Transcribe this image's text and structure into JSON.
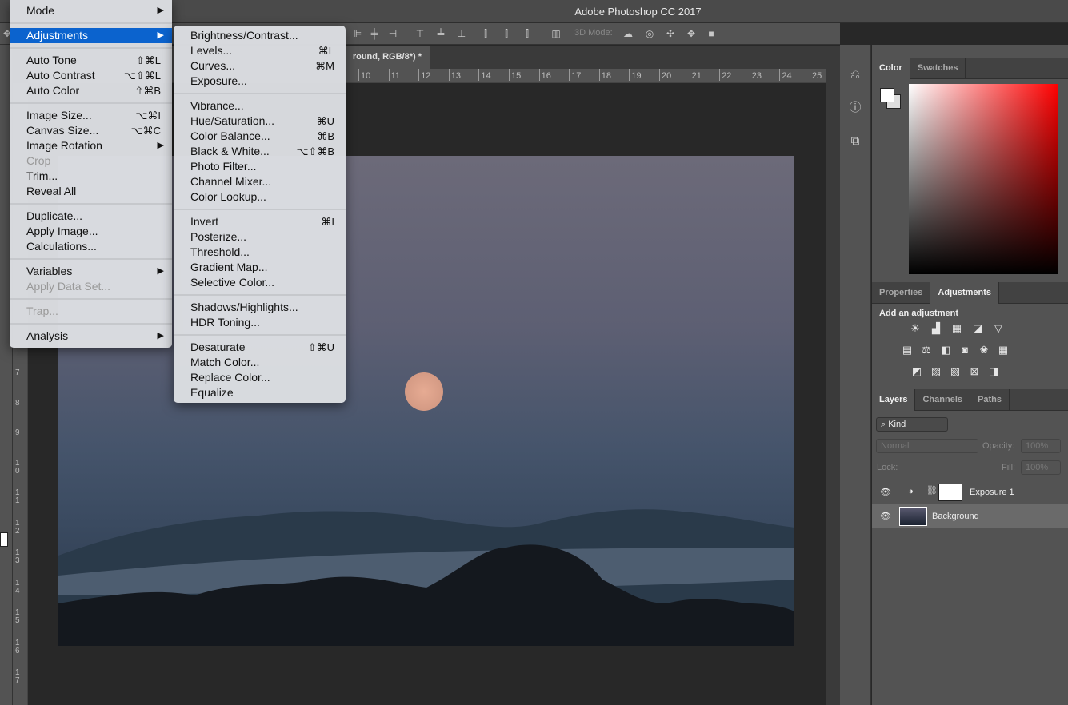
{
  "app": {
    "title": "Adobe Photoshop CC 2017",
    "doc_tab": "round, RGB/8*) *"
  },
  "options_bar": {
    "mode_3d_label": "3D Mode:"
  },
  "rulers": {
    "horizontal": [
      "10",
      "11",
      "12",
      "13",
      "14",
      "15",
      "16",
      "17",
      "18",
      "19",
      "20",
      "21",
      "22",
      "23",
      "24",
      "25"
    ],
    "vertical": [
      "7",
      "8",
      "9",
      "10",
      "11",
      "12",
      "13",
      "14",
      "15",
      "16",
      "17"
    ]
  },
  "main_menu": [
    {
      "label": "Mode",
      "arrow": true
    },
    {
      "sep": true
    },
    {
      "label": "Adjustments",
      "arrow": true,
      "highlight": true
    },
    {
      "sep": true
    },
    {
      "label": "Auto Tone",
      "shortcut": "⇧⌘L"
    },
    {
      "label": "Auto Contrast",
      "shortcut": "⌥⇧⌘L"
    },
    {
      "label": "Auto Color",
      "shortcut": "⇧⌘B"
    },
    {
      "sep": true
    },
    {
      "label": "Image Size...",
      "shortcut": "⌥⌘I"
    },
    {
      "label": "Canvas Size...",
      "shortcut": "⌥⌘C"
    },
    {
      "label": "Image Rotation",
      "arrow": true
    },
    {
      "label": "Crop",
      "disabled": true
    },
    {
      "label": "Trim..."
    },
    {
      "label": "Reveal All"
    },
    {
      "sep": true
    },
    {
      "label": "Duplicate..."
    },
    {
      "label": "Apply Image..."
    },
    {
      "label": "Calculations..."
    },
    {
      "sep": true
    },
    {
      "label": "Variables",
      "arrow": true
    },
    {
      "label": "Apply Data Set...",
      "disabled": true
    },
    {
      "sep": true
    },
    {
      "label": "Trap...",
      "disabled": true
    },
    {
      "sep": true
    },
    {
      "label": "Analysis",
      "arrow": true
    }
  ],
  "adjustments_submenu": [
    {
      "label": "Brightness/Contrast..."
    },
    {
      "label": "Levels...",
      "shortcut": "⌘L"
    },
    {
      "label": "Curves...",
      "shortcut": "⌘M"
    },
    {
      "label": "Exposure..."
    },
    {
      "sep": true
    },
    {
      "label": "Vibrance..."
    },
    {
      "label": "Hue/Saturation...",
      "shortcut": "⌘U"
    },
    {
      "label": "Color Balance...",
      "shortcut": "⌘B"
    },
    {
      "label": "Black & White...",
      "shortcut": "⌥⇧⌘B"
    },
    {
      "label": "Photo Filter..."
    },
    {
      "label": "Channel Mixer..."
    },
    {
      "label": "Color Lookup..."
    },
    {
      "sep": true
    },
    {
      "label": "Invert",
      "shortcut": "⌘I"
    },
    {
      "label": "Posterize..."
    },
    {
      "label": "Threshold..."
    },
    {
      "label": "Gradient Map..."
    },
    {
      "label": "Selective Color..."
    },
    {
      "sep": true
    },
    {
      "label": "Shadows/Highlights..."
    },
    {
      "label": "HDR Toning..."
    },
    {
      "sep": true
    },
    {
      "label": "Desaturate",
      "shortcut": "⇧⌘U"
    },
    {
      "label": "Match Color..."
    },
    {
      "label": "Replace Color..."
    },
    {
      "label": "Equalize"
    }
  ],
  "color_panel": {
    "tabs": [
      "Color",
      "Swatches"
    ],
    "active": "Color",
    "hue_color": "#ff0000"
  },
  "adjust_panel": {
    "tabs": [
      "Properties",
      "Adjustments"
    ],
    "active": "Adjustments",
    "heading": "Add an adjustment"
  },
  "layers_panel": {
    "tabs": [
      "Layers",
      "Channels",
      "Paths"
    ],
    "active": "Layers",
    "filter": "Kind",
    "blend_mode": "Normal",
    "opacity_label": "Opacity:",
    "opacity": "100%",
    "lock_label": "Lock:",
    "fill_label": "Fill:",
    "fill": "100%",
    "layers": [
      {
        "name": "Exposure 1",
        "visible": true
      },
      {
        "name": "Background",
        "visible": true,
        "selected": true
      }
    ]
  },
  "colors": {
    "menu_highlight": "#0b63ce",
    "moon": "#e0a48c"
  }
}
